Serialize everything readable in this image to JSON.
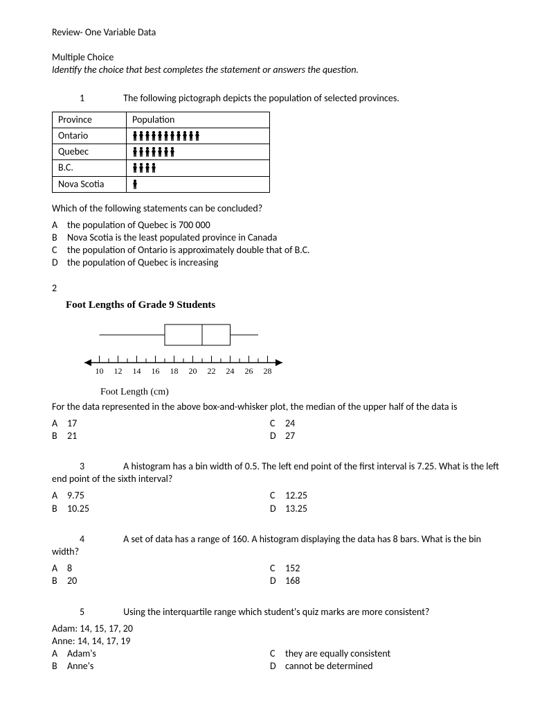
{
  "title": "Review- One Variable Data",
  "mc_heading": "Multiple Choice",
  "instruction": "Identify the choice that best completes the statement or answers the question.",
  "q1": {
    "num": "1",
    "stem": "The following pictograph depicts the population of selected provinces.",
    "table": {
      "headers": [
        "Province",
        "Population"
      ],
      "rows": [
        {
          "label": "Ontario",
          "count": 11
        },
        {
          "label": "Quebec",
          "count": 7
        },
        {
          "label": "B.C.",
          "count": 4
        },
        {
          "label": "Nova Scotia",
          "count": 1
        }
      ]
    },
    "followup": "Which of the following statements can be concluded?",
    "choices": {
      "A": "the population of Quebec is 700 000",
      "B": "Nova Scotia is the least populated province in Canada",
      "C": "the population of Ontario is approximately double that of B.C.",
      "D": "the population of Quebec is increasing"
    }
  },
  "q2": {
    "num": "2",
    "chart_title": "Foot Lengths of Grade 9 Students",
    "chart_caption": "Foot Length (cm)",
    "stem": "For the data represented in the above box-and-whisker plot, the median of the upper half of the data is",
    "choices": {
      "A": "17",
      "B": "21",
      "C": "24",
      "D": "27"
    }
  },
  "q3": {
    "num": "3",
    "stem": "A histogram has a bin width of 0.5. The left end point of the first interval is 7.25. What is the left end point of the sixth interval?",
    "choices": {
      "A": "9.75",
      "B": "10.25",
      "C": "12.25",
      "D": "13.25"
    }
  },
  "q4": {
    "num": "4",
    "stem": "A set of data has a range of 160. A histogram displaying the data has 8 bars. What is the bin width?",
    "choices": {
      "A": "8",
      "B": "20",
      "C": "152",
      "D": "168"
    }
  },
  "q5": {
    "num": "5",
    "stem": "Using the interquartile range which student's quiz marks are more consistent?",
    "data_lines": [
      "Adam: 14, 15, 17, 20",
      "Anne:  14, 14, 17, 19"
    ],
    "choices": {
      "A": "Adam's",
      "B": "Anne's",
      "C": "they are equally consistent",
      "D": "cannot be determined"
    }
  },
  "chart_data": {
    "type": "boxplot",
    "title": "Foot Lengths of Grade 9 Students",
    "xlabel": "Foot Length (cm)",
    "axis_ticks": [
      10,
      12,
      14,
      16,
      18,
      20,
      22,
      24,
      26,
      28
    ],
    "min": 10,
    "q1": 17,
    "median": 21,
    "q3": 24,
    "max": 27,
    "xlim": [
      9,
      29
    ]
  }
}
